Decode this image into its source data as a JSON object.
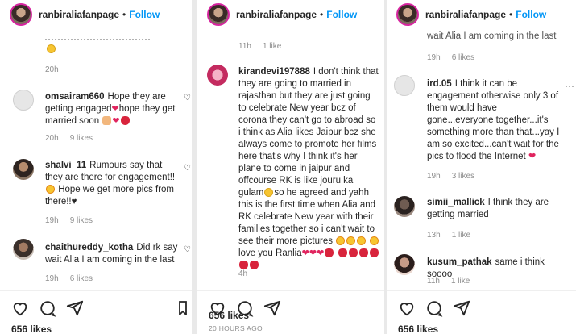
{
  "panels": [
    {
      "header": {
        "username": "ranbiraliafanpage",
        "separator": "•",
        "follow": "Follow"
      },
      "top_time": "20h",
      "comments": [
        {
          "user": "omsairam660",
          "text": "Hope they are getting engaged",
          "text2": "hope they get married soon",
          "time": "20h",
          "likes": "9 likes"
        },
        {
          "user": "shalvi_11",
          "text": "Rumours say that they are there for engagement!!",
          "text2": "Hope we get more pics from there!!",
          "time": "19h",
          "likes": "9 likes"
        },
        {
          "user": "chaithureddy_kotha",
          "text": "Did rk say wait Alia I am coming in the last",
          "time": "19h",
          "likes": "6 likes"
        }
      ],
      "likes": "656 likes"
    },
    {
      "header": {
        "username": "ranbiraliafanpage",
        "separator": "•",
        "follow": "Follow"
      },
      "top_meta": {
        "time": "11h",
        "likes": "1 like"
      },
      "comment": {
        "user": "kirandevi197888",
        "text": "I don't think that they are going to married in rajasthan but they are just going to celebrate New year bcz of corona they can't go to abroad so i think as Alia likes Jaipur bcz she always come to promote her films here that's why I think it's her plane to come in jaipur and offcourse RK is like jouru ka gulam",
        "text2": "so he agreed and yahh this is the first time when Alia and RK celebrate New year with their families together so i can't wait to see their more pictures",
        "text3": "love you Ranlia",
        "time": "4h"
      },
      "likes": "656 likes",
      "posted": "20 HOURS AGO"
    },
    {
      "header": {
        "username": "ranbiraliafanpage",
        "separator": "•",
        "follow": "Follow"
      },
      "top_text": "wait Alia I am coming in the last",
      "top_meta": {
        "time": "19h",
        "likes": "6 likes"
      },
      "comments": [
        {
          "user": "ird.05",
          "text": "I think it can be engagement otherwise only 3 of them would have gone...everyone together...it's something more than that...yay I am so excited...can't wait for the pics to flood the Internet",
          "time": "19h",
          "likes": "3 likes"
        },
        {
          "user": "simii_mallick",
          "text": "I think they are getting married",
          "time": "13h",
          "likes": "1 like"
        },
        {
          "user": "kusum_pathak",
          "text": "same i think soooo",
          "time": "11h",
          "likes": "1 like"
        }
      ],
      "likes": "656 likes"
    }
  ],
  "colors": {
    "accent": "#0095f6",
    "muted": "#8e8e8e",
    "heart": "#e0245e"
  }
}
